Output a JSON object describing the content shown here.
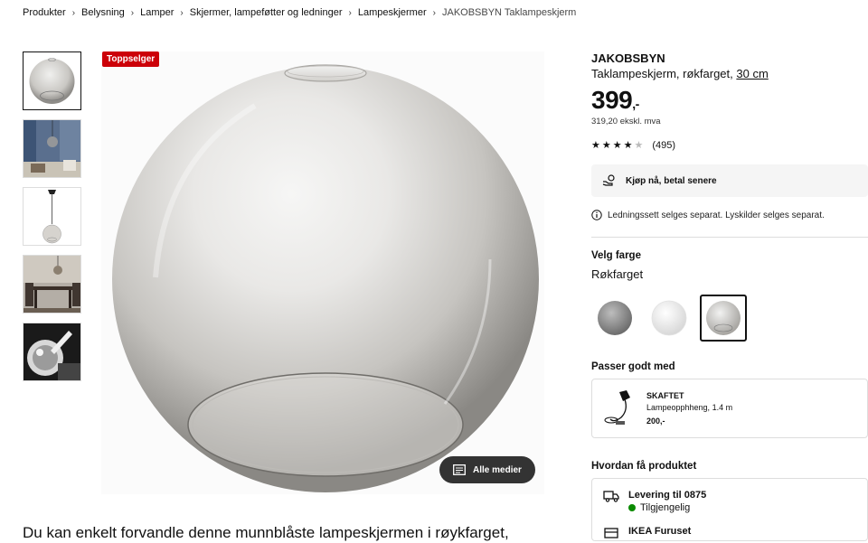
{
  "breadcrumb": {
    "items": [
      "Produkter",
      "Belysning",
      "Lamper",
      "Skjermer, lampeføtter og ledninger",
      "Lampeskjermer"
    ],
    "current": "JAKOBSBYN Taklampeskjerm"
  },
  "media": {
    "badge": "Toppselger",
    "all_media_label": "Alle medier"
  },
  "product": {
    "name": "JAKOBSBYN",
    "desc_text": "Taklampeskjerm, røkfarget, ",
    "size": "30 cm",
    "price_main": "399",
    "price_suffix": ",-",
    "price_ex_vat": "319,20 ekskl. mva",
    "rating_count": "(495)",
    "rating_value": 4.5,
    "pay_later": "Kjøp nå, betal senere",
    "notice": "Ledningssett selges separat. Lyskilder selges separat."
  },
  "colors": {
    "title": "Velg farge",
    "selected_name": "Røkfarget"
  },
  "matches": {
    "title": "Passer godt med",
    "item": {
      "name": "SKAFTET",
      "desc": "Lampeopphheng, 1.4 m",
      "price": "200,-"
    }
  },
  "delivery": {
    "title": "Hvordan få produktet",
    "ship_title": "Levering til 0875",
    "ship_status": "Tilgjengelig",
    "store_title": "IKEA Furuset"
  },
  "description": "Du kan enkelt forvandle denne munnblåste lampeskjermen i røykfarget,",
  "style_colors": {
    "badge_bg": "#cc0008",
    "available": "#0a8a00"
  }
}
